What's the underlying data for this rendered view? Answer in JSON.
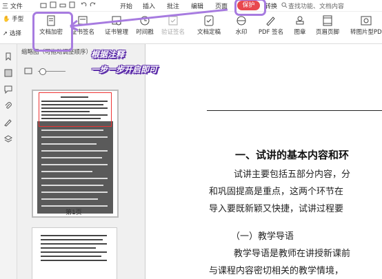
{
  "menubar": {
    "file": "三 文件",
    "items": [
      "开始",
      "插入",
      "批注",
      "编辑",
      "页面",
      "保护",
      "转换"
    ],
    "search": "查找功能、文档内容"
  },
  "toolbar": {
    "hand": "手型",
    "select": "选择",
    "encrypt": "文档加密",
    "cert_sign": "证书签名",
    "cert_manage": "证书管理",
    "timestamp": "时间戳",
    "verify_sign": "验证签名",
    "doc_finalize": "文档定稿",
    "watermark": "水印",
    "pdf_sign": "PDF 签名",
    "stamp": "图章",
    "header_footer": "页眉页脚",
    "to_img_pdf": "转图片型PDF"
  },
  "panel": {
    "title": "缩略图（可拖动调整顺序）",
    "page1_label": "第1页"
  },
  "overlay": {
    "line1": "根据注释",
    "line2": "一步一步开启即可"
  },
  "doc": {
    "heading": "一、试讲的基本内容和环",
    "line1": "试讲主要包括五部分内容，分",
    "line2": "和巩固提高是重点，这两个环节在",
    "line3": "导入要既新颖又快捷，试讲过程要",
    "sub1": "（一）教学导语",
    "line4": "教学导语是教师在讲授新课前",
    "line5": "与课程内容密切相关的教学情境，"
  },
  "colors": {
    "accent_purple": "#a77be0",
    "protect_red": "#e8484f"
  }
}
